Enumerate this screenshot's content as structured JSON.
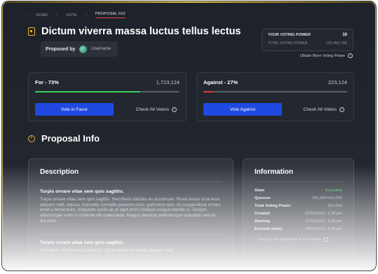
{
  "breadcrumb": [
    "HOME",
    "VOTE",
    "PROPOSAL 010"
  ],
  "proposal": {
    "title": "Dictum viverra massa luctus tellus lectus",
    "proposed_by_label": "Proposed by",
    "username": "Username"
  },
  "voting_power": {
    "label": "YOUR VOTING POWER",
    "value": "10",
    "total_label": "TOTAL VOTING POWER",
    "total_value": "123,456,789",
    "obtain_link": "Obtain More Voting Power"
  },
  "votes": {
    "for": {
      "label": "For - 73%",
      "count": "1,723,124",
      "percent": 73,
      "button": "Vote in Favor",
      "check": "Check All Voters"
    },
    "against": {
      "label": "Against - 27%",
      "count": "223,124",
      "percent": 7,
      "button": "Vote Against",
      "check": "Check All Voters"
    }
  },
  "section_title": "Proposal Info",
  "description": {
    "title": "Description",
    "blocks": [
      {
        "heading": "Turpis ornare vitae sem quis sagittis.",
        "text": "Turpis ornare vitae sem quis sagittis. Sed libero ultricies eu accumsan. Risus lectus urna eros aliquam velit, massa. Convallis convallis posuere risus, parturient quis. Ac suspendisse ornare amet a fermentum. Vulputate sociis ac at eget proin tristique congue blandit ut. Tempor, ullamcorper enim in molestie elit malesuada. Magna placerat pellentesque vulputate sed eu, dui enim"
      },
      {
        "heading": "Turpis ornare vitae sem quis sagittis.",
        "text": "Sed libero ultricies eu accumsan. Risus lectus urna eros aliquam velit."
      }
    ]
  },
  "information": {
    "title": "Information",
    "rows": [
      {
        "k": "State",
        "v": "Executed"
      },
      {
        "k": "Quorum",
        "v": "160,000/160,000"
      },
      {
        "k": "Total Voting Power",
        "v": "324,554"
      },
      {
        "k": "Created",
        "v": "22/10/2021, 1:28 pm"
      },
      {
        "k": "Starting",
        "v": "22/10/2021, 1:28 pm"
      },
      {
        "k": "Execute (max)",
        "v": "22/11/2021, 1:28 pm"
      }
    ],
    "forum_link": "Discuss the proposals at the Forum"
  },
  "colors": {
    "accent": "#1f49e0",
    "for": "#36d15a",
    "against": "#e23b3b",
    "icon": "#f0b429",
    "executed": "#3ec46d"
  },
  "icons": [
    "document-icon",
    "info-icon",
    "arrow-circle-icon",
    "external-link-icon"
  ]
}
